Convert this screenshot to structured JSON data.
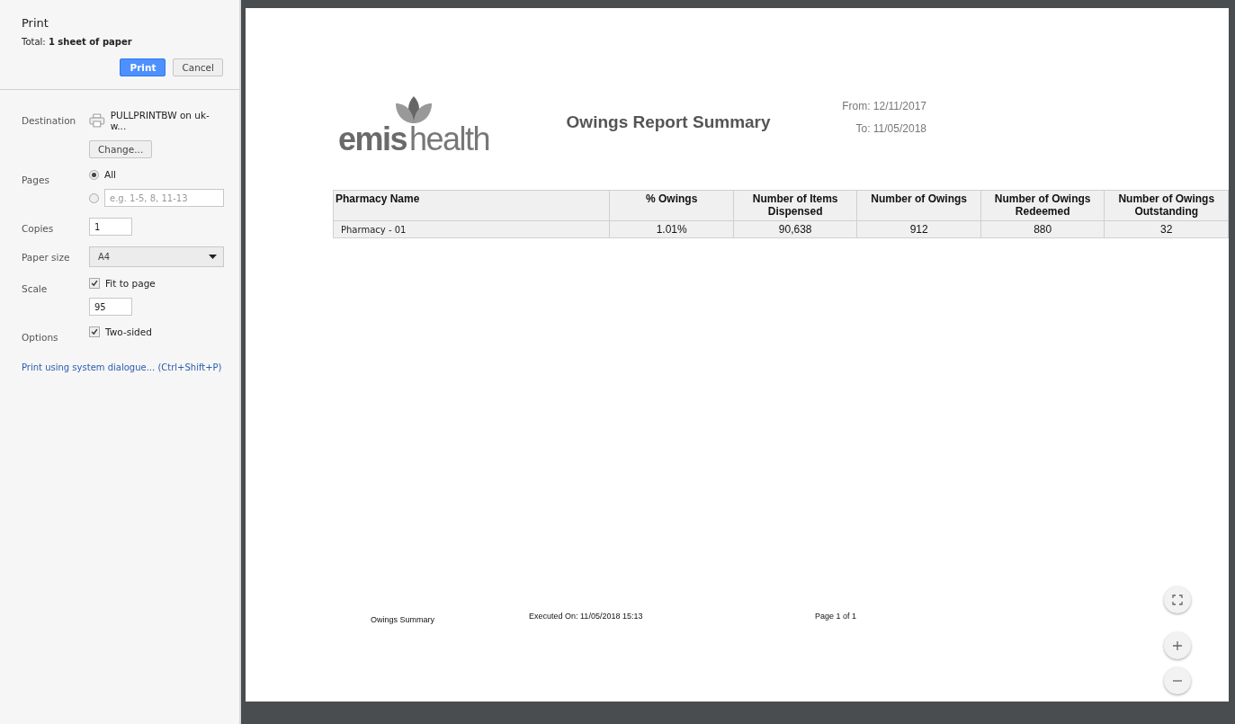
{
  "dialog": {
    "title": "Print",
    "total": "Total: **1 sheet of paper**",
    "buttons": [
      {
        "label": "Print",
        "kind": "primary"
      },
      {
        "label": "Cancel",
        "kind": "secondary"
      }
    ]
  },
  "settings": {
    "destination": {
      "label": "Destination",
      "printer": "PULLPRINTBW on uk-w...",
      "change_button": "Change..."
    },
    "pages": {
      "label": "Pages",
      "options": [
        {
          "kind": "label",
          "label": "All",
          "selected": true
        },
        {
          "kind": "field",
          "placeholder": "e.g. 1-5, 8, 11-13",
          "selected": false
        }
      ]
    },
    "copies": {
      "label": "Copies",
      "value": "1"
    },
    "paper_size": {
      "label": "Paper size",
      "value": "A4"
    },
    "scale": {
      "label": "Scale",
      "fit_label": "Fit to page",
      "checked": true,
      "value": "95"
    },
    "options": {
      "label": "Options",
      "two_sided_label": "Two-sided",
      "checked": true
    },
    "system_link": "Print using system dialogue... (Ctrl+Shift+P)"
  },
  "report": {
    "logo": {
      "word_1": "emis",
      "word_2": "health"
    },
    "title": "Owings Report Summary",
    "from": "From: 12/11/2017",
    "to": "To: 11/05/2018",
    "table": {
      "columns": [
        "Pharmacy  Name",
        "% Owings",
        "Number of Items Dispensed",
        "Number of Owings",
        "Number of Owings Redeemed",
        "Number of Owings Outstanding"
      ],
      "rows": [
        [
          "Pharmacy - 01",
          "1.01%",
          "90,638",
          "912",
          "880",
          "32"
        ]
      ]
    },
    "footer": {
      "left": "Owings Summary",
      "center": "Executed On: 11/05/2018 15:13",
      "right": "Page 1 of 1"
    }
  }
}
